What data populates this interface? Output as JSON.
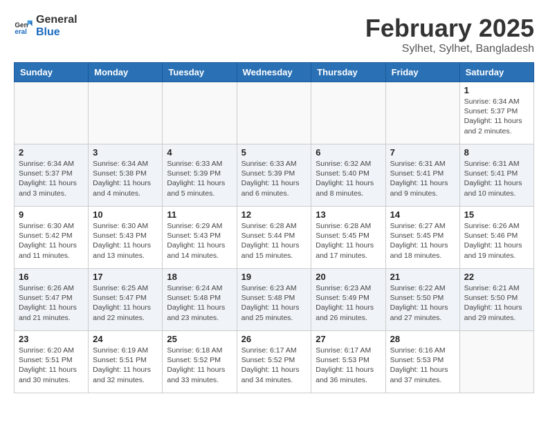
{
  "header": {
    "logo_general": "General",
    "logo_blue": "Blue",
    "month_title": "February 2025",
    "location": "Sylhet, Sylhet, Bangladesh"
  },
  "days_of_week": [
    "Sunday",
    "Monday",
    "Tuesday",
    "Wednesday",
    "Thursday",
    "Friday",
    "Saturday"
  ],
  "weeks": [
    [
      {
        "day": "",
        "info": ""
      },
      {
        "day": "",
        "info": ""
      },
      {
        "day": "",
        "info": ""
      },
      {
        "day": "",
        "info": ""
      },
      {
        "day": "",
        "info": ""
      },
      {
        "day": "",
        "info": ""
      },
      {
        "day": "1",
        "info": "Sunrise: 6:34 AM\nSunset: 5:37 PM\nDaylight: 11 hours and 2 minutes."
      }
    ],
    [
      {
        "day": "2",
        "info": "Sunrise: 6:34 AM\nSunset: 5:37 PM\nDaylight: 11 hours and 3 minutes."
      },
      {
        "day": "3",
        "info": "Sunrise: 6:34 AM\nSunset: 5:38 PM\nDaylight: 11 hours and 4 minutes."
      },
      {
        "day": "4",
        "info": "Sunrise: 6:33 AM\nSunset: 5:39 PM\nDaylight: 11 hours and 5 minutes."
      },
      {
        "day": "5",
        "info": "Sunrise: 6:33 AM\nSunset: 5:39 PM\nDaylight: 11 hours and 6 minutes."
      },
      {
        "day": "6",
        "info": "Sunrise: 6:32 AM\nSunset: 5:40 PM\nDaylight: 11 hours and 8 minutes."
      },
      {
        "day": "7",
        "info": "Sunrise: 6:31 AM\nSunset: 5:41 PM\nDaylight: 11 hours and 9 minutes."
      },
      {
        "day": "8",
        "info": "Sunrise: 6:31 AM\nSunset: 5:41 PM\nDaylight: 11 hours and 10 minutes."
      }
    ],
    [
      {
        "day": "9",
        "info": "Sunrise: 6:30 AM\nSunset: 5:42 PM\nDaylight: 11 hours and 11 minutes."
      },
      {
        "day": "10",
        "info": "Sunrise: 6:30 AM\nSunset: 5:43 PM\nDaylight: 11 hours and 13 minutes."
      },
      {
        "day": "11",
        "info": "Sunrise: 6:29 AM\nSunset: 5:43 PM\nDaylight: 11 hours and 14 minutes."
      },
      {
        "day": "12",
        "info": "Sunrise: 6:28 AM\nSunset: 5:44 PM\nDaylight: 11 hours and 15 minutes."
      },
      {
        "day": "13",
        "info": "Sunrise: 6:28 AM\nSunset: 5:45 PM\nDaylight: 11 hours and 17 minutes."
      },
      {
        "day": "14",
        "info": "Sunrise: 6:27 AM\nSunset: 5:45 PM\nDaylight: 11 hours and 18 minutes."
      },
      {
        "day": "15",
        "info": "Sunrise: 6:26 AM\nSunset: 5:46 PM\nDaylight: 11 hours and 19 minutes."
      }
    ],
    [
      {
        "day": "16",
        "info": "Sunrise: 6:26 AM\nSunset: 5:47 PM\nDaylight: 11 hours and 21 minutes."
      },
      {
        "day": "17",
        "info": "Sunrise: 6:25 AM\nSunset: 5:47 PM\nDaylight: 11 hours and 22 minutes."
      },
      {
        "day": "18",
        "info": "Sunrise: 6:24 AM\nSunset: 5:48 PM\nDaylight: 11 hours and 23 minutes."
      },
      {
        "day": "19",
        "info": "Sunrise: 6:23 AM\nSunset: 5:48 PM\nDaylight: 11 hours and 25 minutes."
      },
      {
        "day": "20",
        "info": "Sunrise: 6:23 AM\nSunset: 5:49 PM\nDaylight: 11 hours and 26 minutes."
      },
      {
        "day": "21",
        "info": "Sunrise: 6:22 AM\nSunset: 5:50 PM\nDaylight: 11 hours and 27 minutes."
      },
      {
        "day": "22",
        "info": "Sunrise: 6:21 AM\nSunset: 5:50 PM\nDaylight: 11 hours and 29 minutes."
      }
    ],
    [
      {
        "day": "23",
        "info": "Sunrise: 6:20 AM\nSunset: 5:51 PM\nDaylight: 11 hours and 30 minutes."
      },
      {
        "day": "24",
        "info": "Sunrise: 6:19 AM\nSunset: 5:51 PM\nDaylight: 11 hours and 32 minutes."
      },
      {
        "day": "25",
        "info": "Sunrise: 6:18 AM\nSunset: 5:52 PM\nDaylight: 11 hours and 33 minutes."
      },
      {
        "day": "26",
        "info": "Sunrise: 6:17 AM\nSunset: 5:52 PM\nDaylight: 11 hours and 34 minutes."
      },
      {
        "day": "27",
        "info": "Sunrise: 6:17 AM\nSunset: 5:53 PM\nDaylight: 11 hours and 36 minutes."
      },
      {
        "day": "28",
        "info": "Sunrise: 6:16 AM\nSunset: 5:53 PM\nDaylight: 11 hours and 37 minutes."
      },
      {
        "day": "",
        "info": ""
      }
    ]
  ]
}
